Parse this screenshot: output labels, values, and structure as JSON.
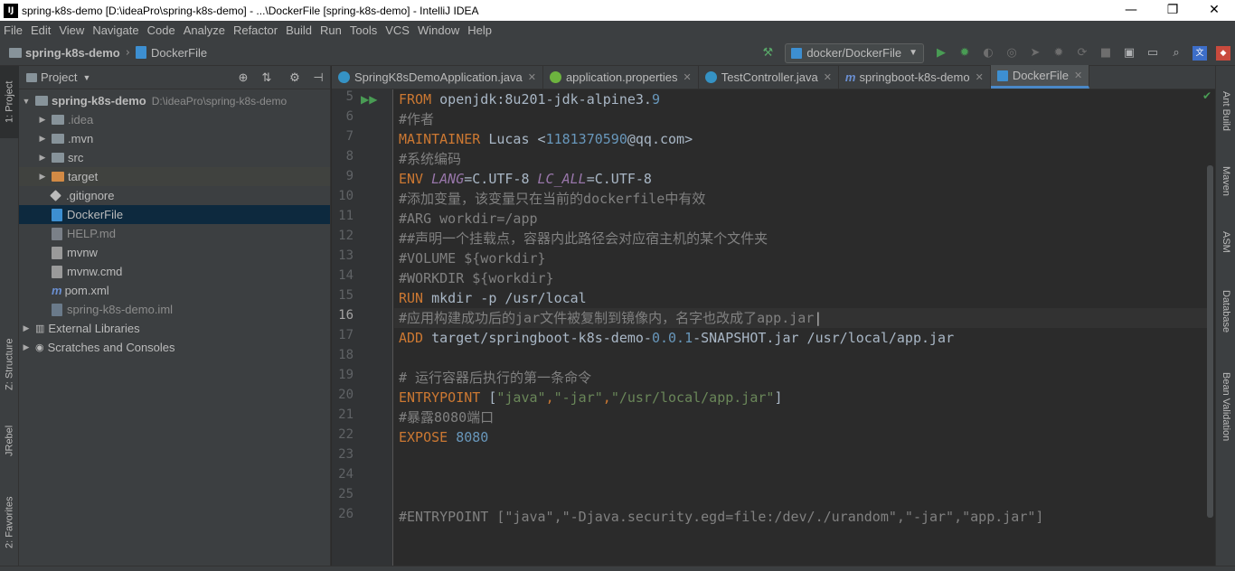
{
  "window": {
    "app_icon": "IJ",
    "title": "spring-k8s-demo [D:\\ideaPro\\spring-k8s-demo] - ...\\DockerFile [spring-k8s-demo] - IntelliJ IDEA",
    "minimize": "—",
    "maximize": "❐",
    "close": "✕"
  },
  "menu": [
    "File",
    "Edit",
    "View",
    "Navigate",
    "Code",
    "Analyze",
    "Refactor",
    "Build",
    "Run",
    "Tools",
    "VCS",
    "Window",
    "Help"
  ],
  "breadcrumb": {
    "project": "spring-k8s-demo",
    "file": "DockerFile"
  },
  "run_config": {
    "label": "docker/DockerFile"
  },
  "left_tool_tabs": {
    "project": "1: Project",
    "structure": "Z: Structure",
    "jrebel": "JRebel",
    "favorites": "2: Favorites"
  },
  "right_tool_tabs": {
    "ant": "Ant Build",
    "maven": "Maven",
    "asm": "ASM",
    "database": "Database",
    "bean": "Bean Validation"
  },
  "project_panel": {
    "title": "Project",
    "tree": [
      {
        "label": "spring-k8s-demo",
        "path": "D:\\ideaPro\\spring-k8s-demo",
        "icon": "folder-icon"
      },
      {
        "label": ".idea",
        "icon": "folder-icon"
      },
      {
        "label": ".mvn",
        "icon": "folder-icon"
      },
      {
        "label": "src",
        "icon": "folder-icon"
      },
      {
        "label": "target",
        "icon": "folder-orange-icon"
      },
      {
        "label": ".gitignore",
        "icon": "gitignore-icon"
      },
      {
        "label": "DockerFile",
        "icon": "docker-icon"
      },
      {
        "label": "HELP.md",
        "icon": "markdown-icon"
      },
      {
        "label": "mvnw",
        "icon": "file-icon"
      },
      {
        "label": "mvnw.cmd",
        "icon": "file-icon"
      },
      {
        "label": "pom.xml",
        "icon": "maven-icon"
      },
      {
        "label": "spring-k8s-demo.iml",
        "icon": "iml-icon"
      },
      {
        "label": "External Libraries",
        "icon": "library-icon"
      },
      {
        "label": "Scratches and Consoles",
        "icon": "scratch-icon"
      }
    ]
  },
  "tabs": [
    {
      "label": "SpringK8sDemoApplication.java",
      "icon": "java-class-icon"
    },
    {
      "label": "application.properties",
      "icon": "spring-properties-icon"
    },
    {
      "label": "TestController.java",
      "icon": "java-class-icon"
    },
    {
      "label": "springboot-k8s-demo",
      "icon": "maven-icon"
    },
    {
      "label": "DockerFile",
      "icon": "docker-icon"
    }
  ],
  "editor": {
    "line_numbers": [
      "5",
      "6",
      "7",
      "8",
      "9",
      "10",
      "11",
      "12",
      "13",
      "14",
      "15",
      "16",
      "17",
      "18",
      "19",
      "20",
      "21",
      "22",
      "23",
      "24",
      "25",
      "26"
    ],
    "current_line": "16",
    "lines": {
      "l5a": "FROM",
      "l5b": " openjdk:8u201-jdk-alpine3.",
      "l5c": "9",
      "l6": "#作者",
      "l7a": "MAINTAINER",
      "l7b": " Lucas <",
      "l7c": "1181370590",
      "l7d": "@qq.com>",
      "l8": "#系统编码",
      "l9a": "ENV",
      "l9b": " ",
      "l9c": "LANG",
      "l9d": "=C.UTF-8 ",
      "l9e": "LC_ALL",
      "l9f": "=C.UTF-8",
      "l10": "#添加变量，该变量只在当前的dockerfile中有效",
      "l11": "#ARG workdir=/app",
      "l12": "##声明一个挂载点，容器内此路径会对应宿主机的某个文件夹",
      "l13": "#VOLUME ${workdir}",
      "l14": "#WORKDIR ${workdir}",
      "l15a": "RUN",
      "l15b": " mkdir -p /usr/local",
      "l16": "#应用构建成功后的jar文件被复制到镜像内，名字也改成了app.jar",
      "l17a": "ADD",
      "l17b": " target/springboot-k8s-demo-",
      "l17c": "0.0.1",
      "l17d": "-SNAPSHOT.jar /usr/local/app.jar",
      "l19": "# 运行容器后执行的第一条命令",
      "l20a": "ENTRYPOINT",
      "l20b": " [",
      "l20c": "\"java\"",
      "l20d": ",",
      "l20e": "\"-jar\"",
      "l20f": ",",
      "l20g": "\"/usr/local/app.jar\"",
      "l20h": "]",
      "l21": "#暴露8080端口",
      "l22a": "EXPOSE",
      "l22b": " ",
      "l22c": "8080",
      "l26": "#ENTRYPOINT [\"java\",\"-Djava.security.egd=file:/dev/./urandom\",\"-jar\",\"app.jar\"]"
    }
  },
  "colors": {
    "keyword": "#cc7832",
    "comment": "#808080",
    "string": "#6a8759",
    "number": "#6897bb",
    "variable": "#9876aa",
    "selection": "#0d293e"
  }
}
